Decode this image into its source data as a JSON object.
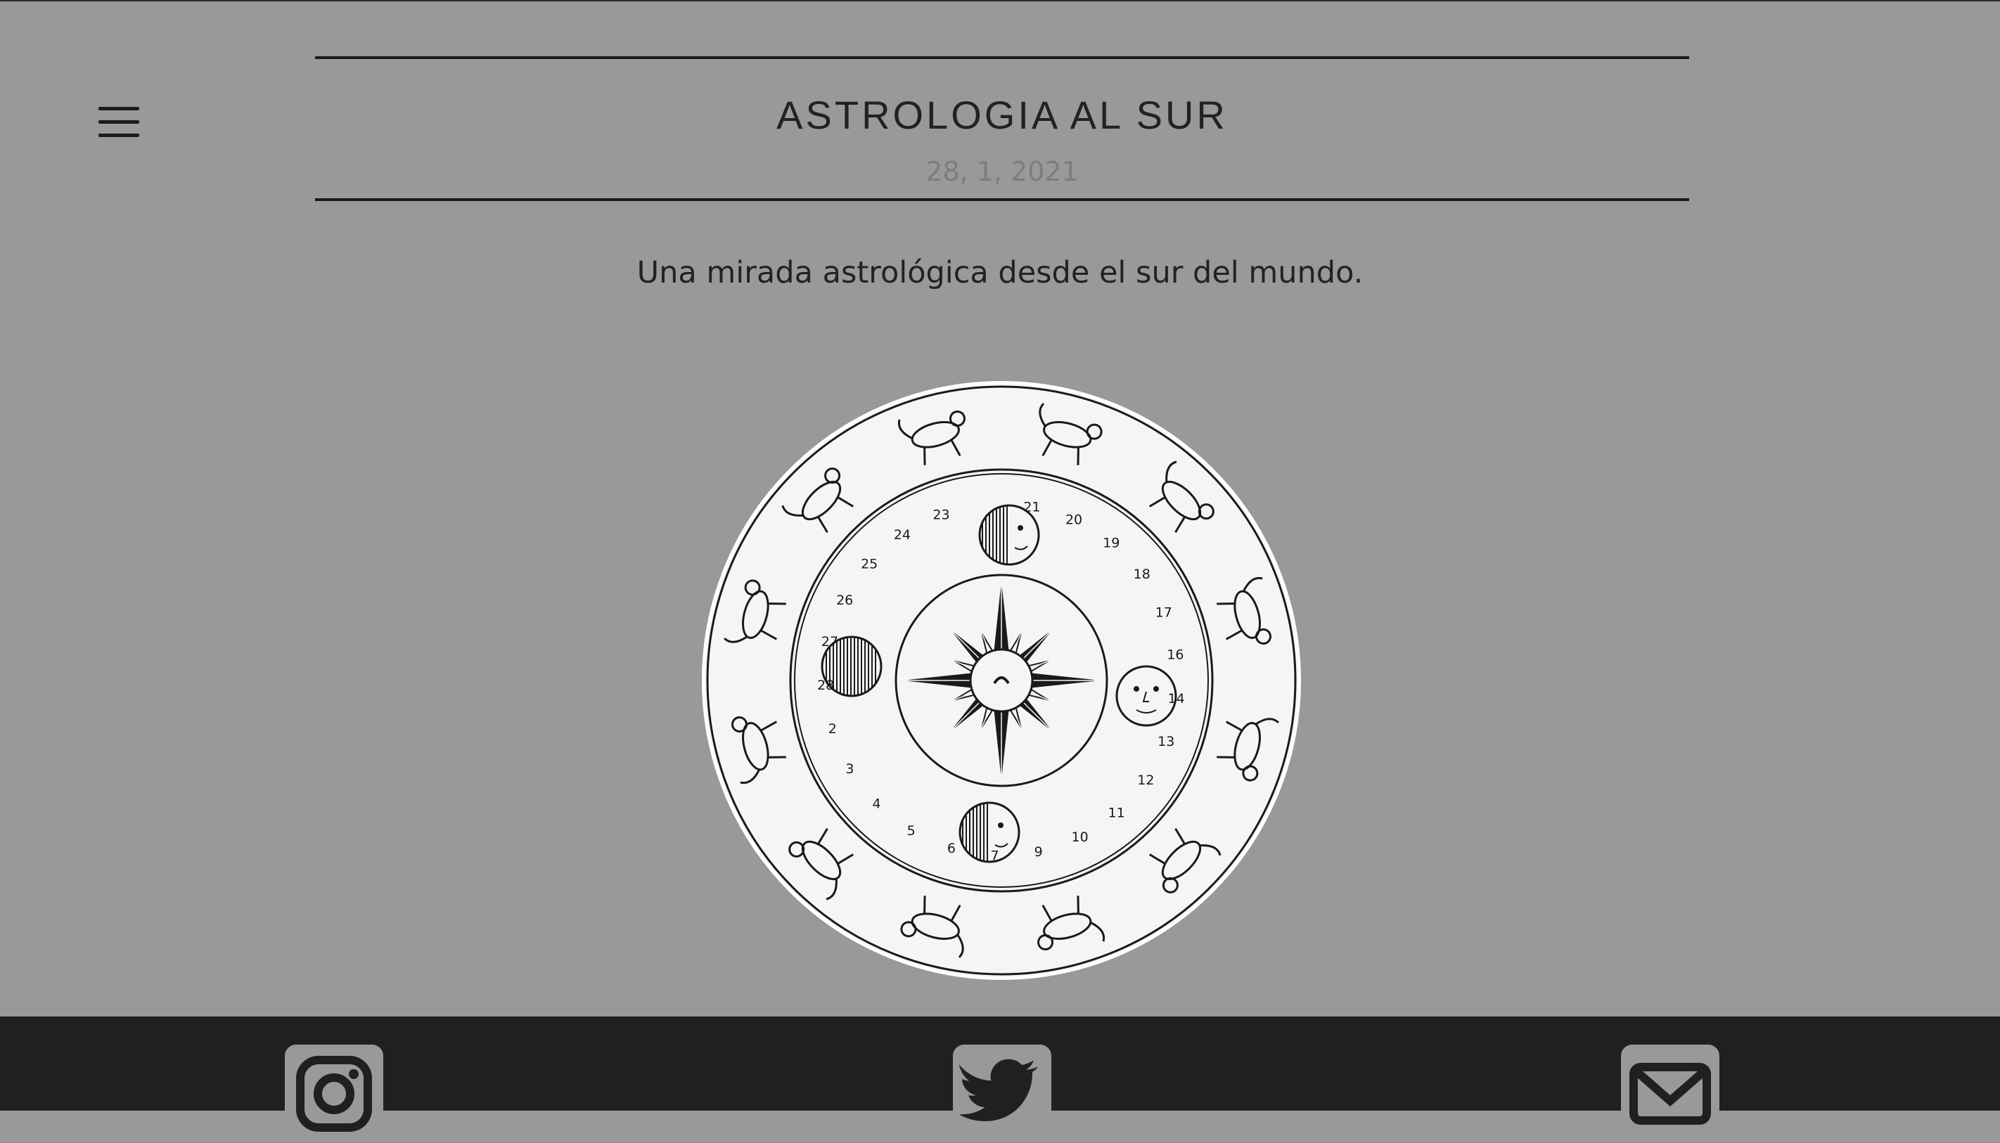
{
  "site": {
    "title": "ASTROLOGIA AL SUR",
    "date": "28, 1, 2021",
    "tagline": "Una mirada astrológica desde el sur del mundo."
  },
  "header": {
    "menu_icon": "hamburger-menu-icon"
  },
  "illustration": {
    "description_icon": "zodiac-wheel-illustration",
    "day_numbers": [
      "21",
      "20",
      "19",
      "18",
      "17",
      "16",
      "14",
      "13",
      "12",
      "11",
      "10",
      "9",
      "7",
      "6",
      "5",
      "4",
      "3",
      "2",
      "28",
      "27",
      "26",
      "25",
      "24",
      "23"
    ]
  },
  "footer": {
    "links": [
      {
        "icon": "instagram-icon"
      },
      {
        "icon": "twitter-icon"
      },
      {
        "icon": "mail-icon"
      }
    ]
  },
  "colors": {
    "background": "#999999",
    "footer": "#202020",
    "text": "#222222",
    "date": "#7d7d7d"
  }
}
